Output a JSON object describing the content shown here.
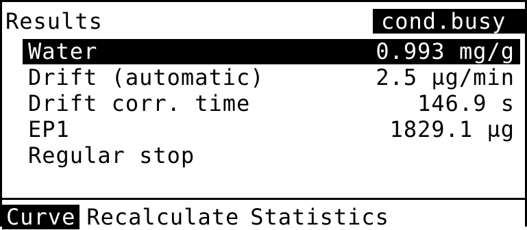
{
  "header": {
    "title": "Results",
    "status": "cond.busy"
  },
  "results": [
    {
      "label": "Water",
      "value": "0.993 mg/g",
      "selected": true
    },
    {
      "label": "Drift (automatic)",
      "value": "2.5 µg/min",
      "selected": false
    },
    {
      "label": "Drift corr. time",
      "value": "146.9 s",
      "selected": false
    },
    {
      "label": "EP1",
      "value": "1829.1 µg",
      "selected": false
    },
    {
      "label": "Regular stop",
      "value": "",
      "selected": false
    }
  ],
  "softkeys": [
    {
      "label": "Curve",
      "active": true
    },
    {
      "label": "Recalculate",
      "active": false
    },
    {
      "label": "Statistics",
      "active": false
    }
  ]
}
